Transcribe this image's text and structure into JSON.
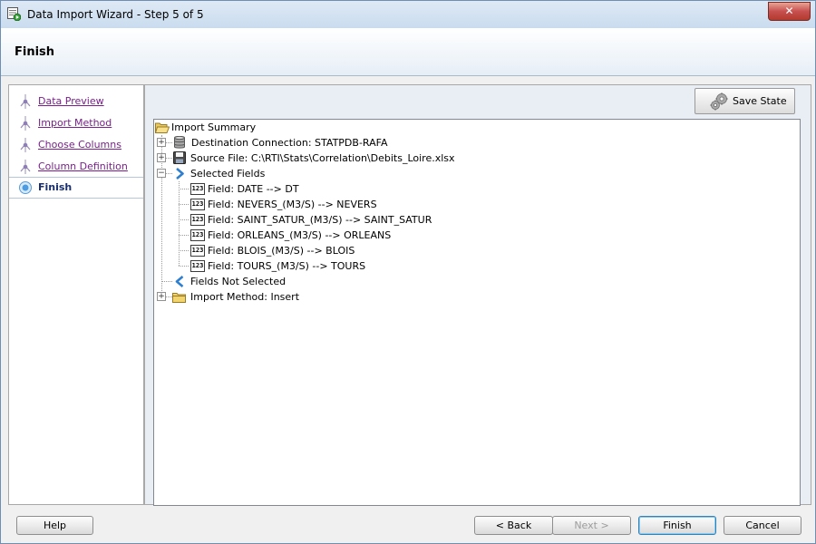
{
  "window": {
    "title": "Data Import Wizard - Step 5 of 5",
    "close_label": "✕"
  },
  "header": {
    "title": "Finish"
  },
  "steps": [
    {
      "label": "Data Preview"
    },
    {
      "label": "Import Method"
    },
    {
      "label": "Choose Columns"
    },
    {
      "label": "Column Definition"
    },
    {
      "label": "Finish"
    }
  ],
  "toolbar": {
    "save_state_label": "Save State"
  },
  "tree": {
    "root": "Import Summary",
    "destination": "Destination Connection: STATPDB-RAFA",
    "source": "Source File: C:\\RTI\\Stats\\Correlation\\Debits_Loire.xlsx",
    "selected_fields": "Selected Fields",
    "field_icon_text": "123",
    "fields": [
      "Field: DATE  --> DT",
      "Field: NEVERS_(M3/S)  --> NEVERS",
      "Field: SAINT_SATUR_(M3/S)  --> SAINT_SATUR",
      "Field: ORLEANS_(M3/S)  --> ORLEANS",
      "Field: BLOIS_(M3/S)  --> BLOIS",
      "Field: TOURS_(M3/S)  --> TOURS"
    ],
    "fields_not_selected": "Fields Not Selected",
    "import_method": "Import Method: Insert"
  },
  "footer": {
    "help": "Help",
    "back": "< Back",
    "next": "Next >",
    "finish": "Finish",
    "cancel": "Cancel"
  },
  "colors": {
    "step_link": "#7a1f8c",
    "current_step": "#1a2f6b",
    "arrow_blue": "#2f7fd0"
  }
}
